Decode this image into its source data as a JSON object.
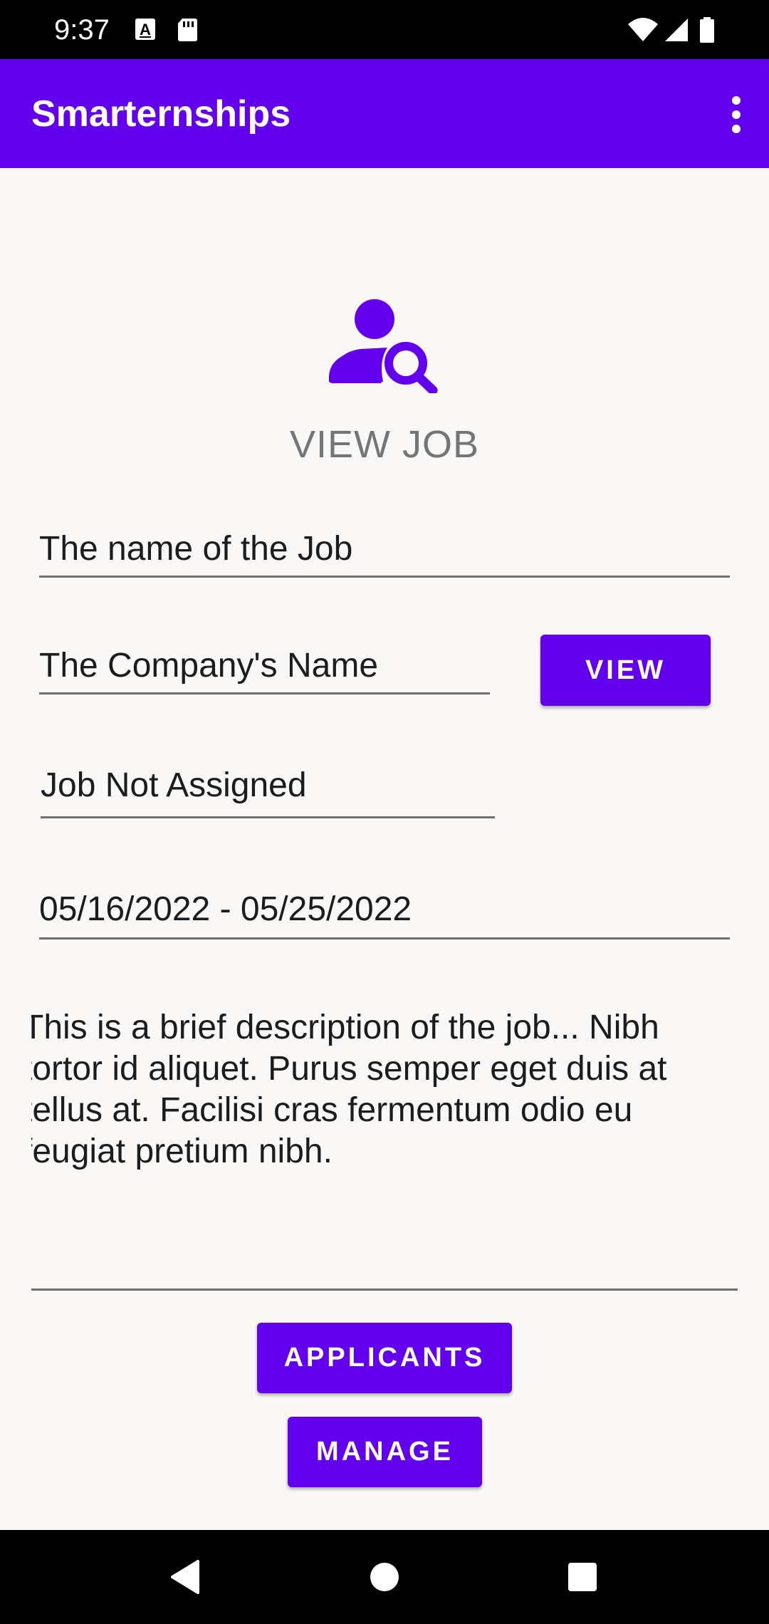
{
  "status_bar": {
    "time": "9:37",
    "left_icons": [
      "a-notification-icon",
      "sd-card-icon"
    ],
    "right_icons": [
      "wifi-icon",
      "signal-icon",
      "battery-icon"
    ]
  },
  "app_bar": {
    "title": "Smarternships",
    "overflow_icon": "more-vert-icon"
  },
  "header": {
    "icon": "person-search-icon",
    "title": "VIEW JOB"
  },
  "form": {
    "job_name": "The name of the Job",
    "company_name": "The Company's Name",
    "view_button": "VIEW",
    "assignment_status": "Job Not Assigned",
    "date_range": "05/16/2022 - 05/25/2022",
    "description": "This is a brief description of the job... Nibh\ntortor id aliquet. Purus semper eget duis at\ntellus at. Facilisi cras fermentum odio eu\nfeugiat pretium nibh."
  },
  "actions": {
    "applicants_button": "APPLICANTS",
    "manage_button": "MANAGE"
  },
  "nav_bar": {
    "icons": [
      "back-icon",
      "home-icon",
      "recents-icon"
    ]
  },
  "colors": {
    "primary": "#6200ee",
    "background": "#f9f8f6",
    "title_gray": "#757575"
  }
}
